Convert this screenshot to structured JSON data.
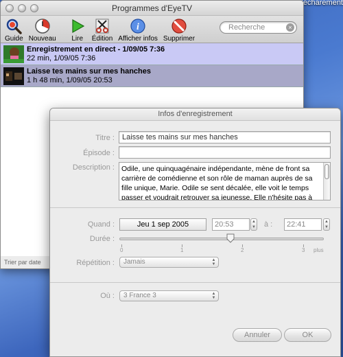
{
  "desktop": {
    "label": "télécharement"
  },
  "main_window": {
    "title": "Programmes d'EyeTV",
    "toolbar": {
      "buttons": [
        {
          "label": "Guide",
          "icon": "magnifier-icon"
        },
        {
          "label": "Nouveau",
          "icon": "new-clock-icon"
        },
        {
          "label": "Lire",
          "icon": "play-icon"
        },
        {
          "label": "Édition",
          "icon": "scissors-icon"
        },
        {
          "label": "Afficher infos",
          "icon": "info-icon"
        },
        {
          "label": "Supprimer",
          "icon": "delete-icon"
        }
      ],
      "search_placeholder": "Recherche"
    },
    "recordings": [
      {
        "title": "Enregistrement en direct - 1/09/05 7:36",
        "detail": "22 min, 1/09/05 7:36"
      },
      {
        "title": "Laisse tes mains sur mes hanches",
        "detail": "1 h 48 min, 1/09/05 20:53"
      }
    ],
    "status": "Trier par date"
  },
  "dialog": {
    "title": "Infos d'enregistrement",
    "titre_label": "Titre :",
    "titre_value": "Laisse tes mains sur mes hanches",
    "episode_label": "Épisode :",
    "episode_value": "",
    "description_label": "Description :",
    "description_value": "Odile, une quinquagénaire indépendante, mène de front sa carrière de comédienne et son rôle de maman auprès de sa fille unique, Marie. Odile se sent décalée, elle voit le temps passer et voudrait retrouver sa jeunesse. Elle n'hésite pas à sortir en boîte pour draguer des jeunes hommes mais se retrouve",
    "quand_label": "Quand :",
    "date_value": "Jeu 1 sep 2005",
    "start_time": "20:53",
    "a_label": "à :",
    "end_time": "22:41",
    "duree_label": "Durée :",
    "duree_hours": 1.8,
    "duree_ticks": [
      "0",
      "1",
      "2",
      "3"
    ],
    "duree_plus": "plus",
    "repetition_label": "Répétition :",
    "repetition_value": "Jamais",
    "ou_label": "Où :",
    "ou_value": "3 France 3",
    "cancel_label": "Annuler",
    "ok_label": "OK"
  },
  "colors": {
    "row1_bg": "#c9c9f5",
    "row2_bg": "#a8a8c8",
    "desktop_blue": "#4a7ad0"
  }
}
